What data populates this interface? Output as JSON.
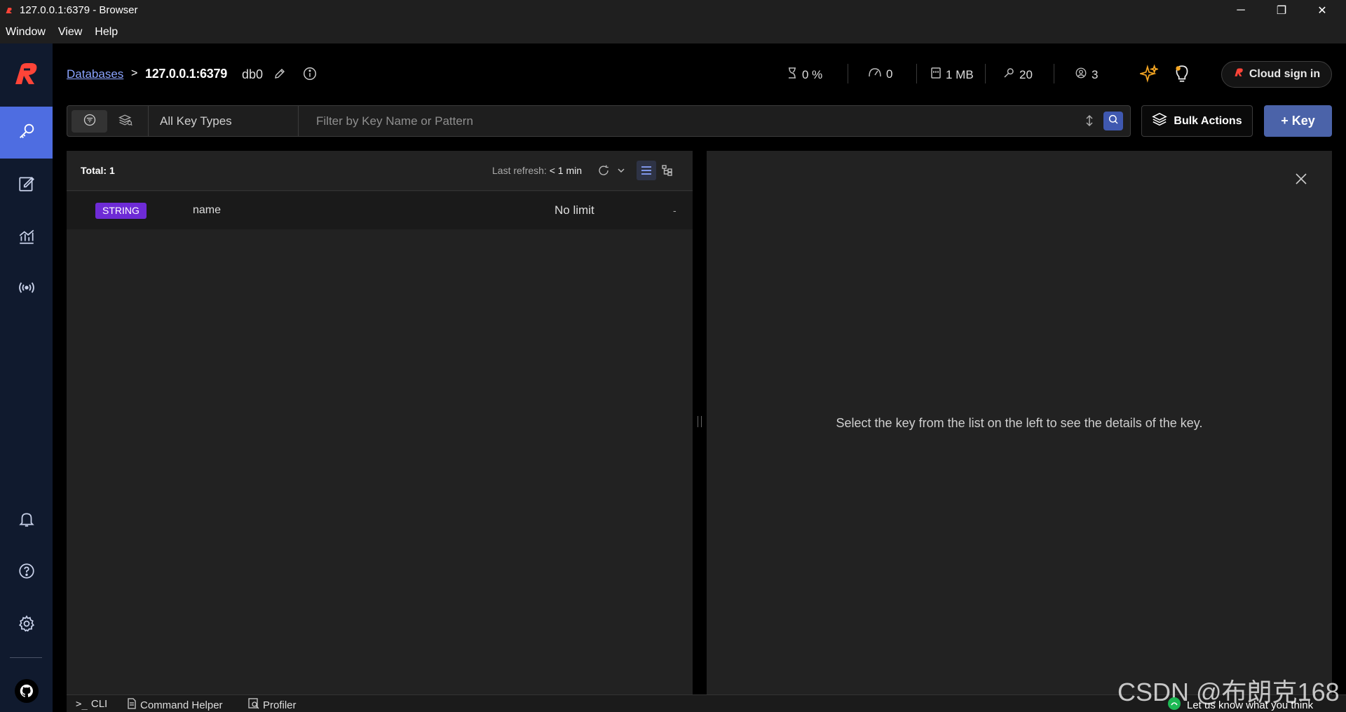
{
  "window": {
    "title": "127.0.0.1:6379 - Browser",
    "minimize": "─",
    "restore": "❐",
    "close": "✕"
  },
  "menu": [
    "Window",
    "View",
    "Help"
  ],
  "breadcrumb": {
    "databases_label": "Databases",
    "separator": ">",
    "host": "127.0.0.1:6379",
    "db": "db0"
  },
  "stats": {
    "cpu": "0 %",
    "ops": "0",
    "memory": "1 MB",
    "keys": "20",
    "clients": "3"
  },
  "cloud_signin": "Cloud sign in",
  "filter": {
    "key_type": "All Key Types",
    "search_placeholder": "Filter by Key Name or Pattern",
    "search_value": ""
  },
  "buttons": {
    "bulk_actions": "Bulk Actions",
    "add_key": "+ Key"
  },
  "list": {
    "total": "Total: 1",
    "last_refresh_label": "Last refresh:",
    "last_refresh_value": "< 1 min",
    "rows": [
      {
        "type": "STRING",
        "name": "name",
        "ttl": "No limit",
        "size": "-"
      }
    ]
  },
  "details": {
    "empty_message": "Select the key from the list on the left to see the details of the key."
  },
  "bottom": {
    "cli": "CLI",
    "command_helper": "Command Helper",
    "profiler": "Profiler",
    "feedback": "Let us know what you think"
  },
  "watermark": "CSDN @布朗克168",
  "colors": {
    "accent": "#4e6de1",
    "brand_red": "#ff4438",
    "string_badge": "#6e2bd6",
    "link": "#8ba4ff"
  }
}
